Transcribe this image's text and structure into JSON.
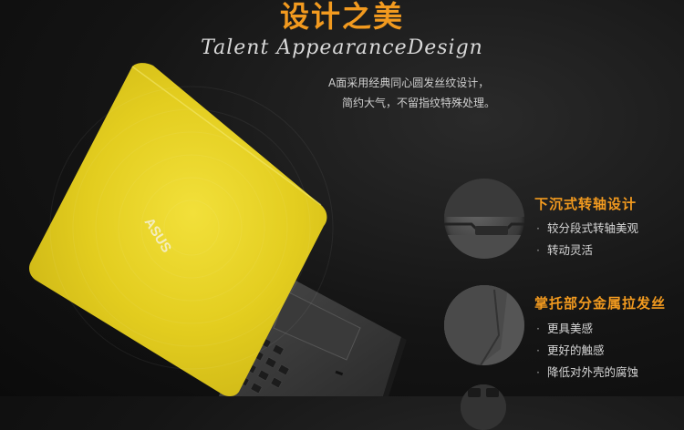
{
  "header": {
    "title": "设计之美",
    "subtitle": "Talent AppearanceDesign",
    "desc_line1": "A面采用经典同心圆发丝纹设计，",
    "desc_line2": "简约大气，不留指纹特殊处理。"
  },
  "laptop": {
    "logo": "ASUS",
    "lid_color": "#e3cd1f"
  },
  "features": [
    {
      "title": "下沉式转轴设计",
      "items": [
        "较分段式转轴美观",
        "转动灵活"
      ]
    },
    {
      "title": "掌托部分金属拉发丝",
      "items": [
        "更具美感",
        "更好的触感",
        "降低对外壳的腐蚀"
      ]
    }
  ],
  "colors": {
    "accent": "#f29a1f",
    "background": "#141414"
  }
}
